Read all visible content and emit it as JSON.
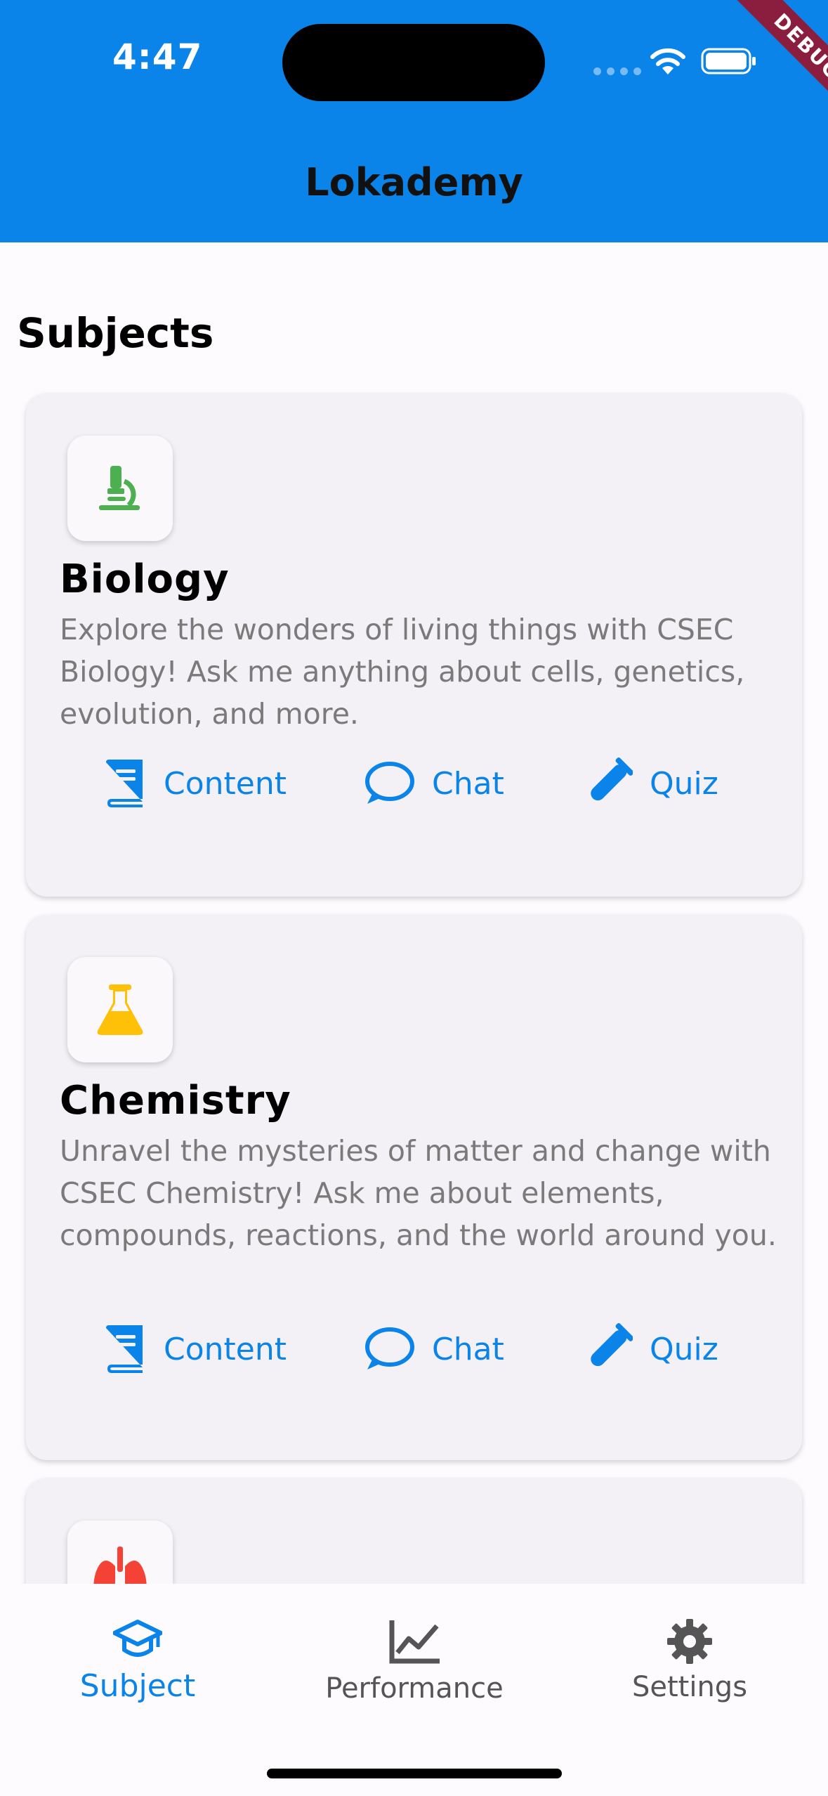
{
  "status_bar": {
    "time": "4:47",
    "debug_label": "DEBUG"
  },
  "app_bar": {
    "title": "Lokademy"
  },
  "section_title": "Subjects",
  "colors": {
    "accent": "#0a84e8",
    "biology": "#4caf50",
    "chemistry": "#ffc107",
    "third": "#f44336"
  },
  "subjects": [
    {
      "icon": "microscope-icon",
      "title": "Biology",
      "description": "Explore the wonders of living things with CSEC Biology! Ask me anything about cells, genetics, evolution, and more."
    },
    {
      "icon": "flask-icon",
      "title": "Chemistry",
      "description": "Unravel the mysteries of matter and change with CSEC Chemistry! Ask me about elements, compounds, reactions, and the world around you."
    },
    {
      "icon": "lungs-icon",
      "title": "",
      "description": ""
    }
  ],
  "actions": {
    "content": "Content",
    "chat": "Chat",
    "quiz": "Quiz"
  },
  "bottom_nav": {
    "items": [
      {
        "label": "Subject",
        "icon": "graduation-cap-icon",
        "active": true
      },
      {
        "label": "Performance",
        "icon": "line-chart-icon",
        "active": false
      },
      {
        "label": "Settings",
        "icon": "gear-icon",
        "active": false
      }
    ]
  }
}
